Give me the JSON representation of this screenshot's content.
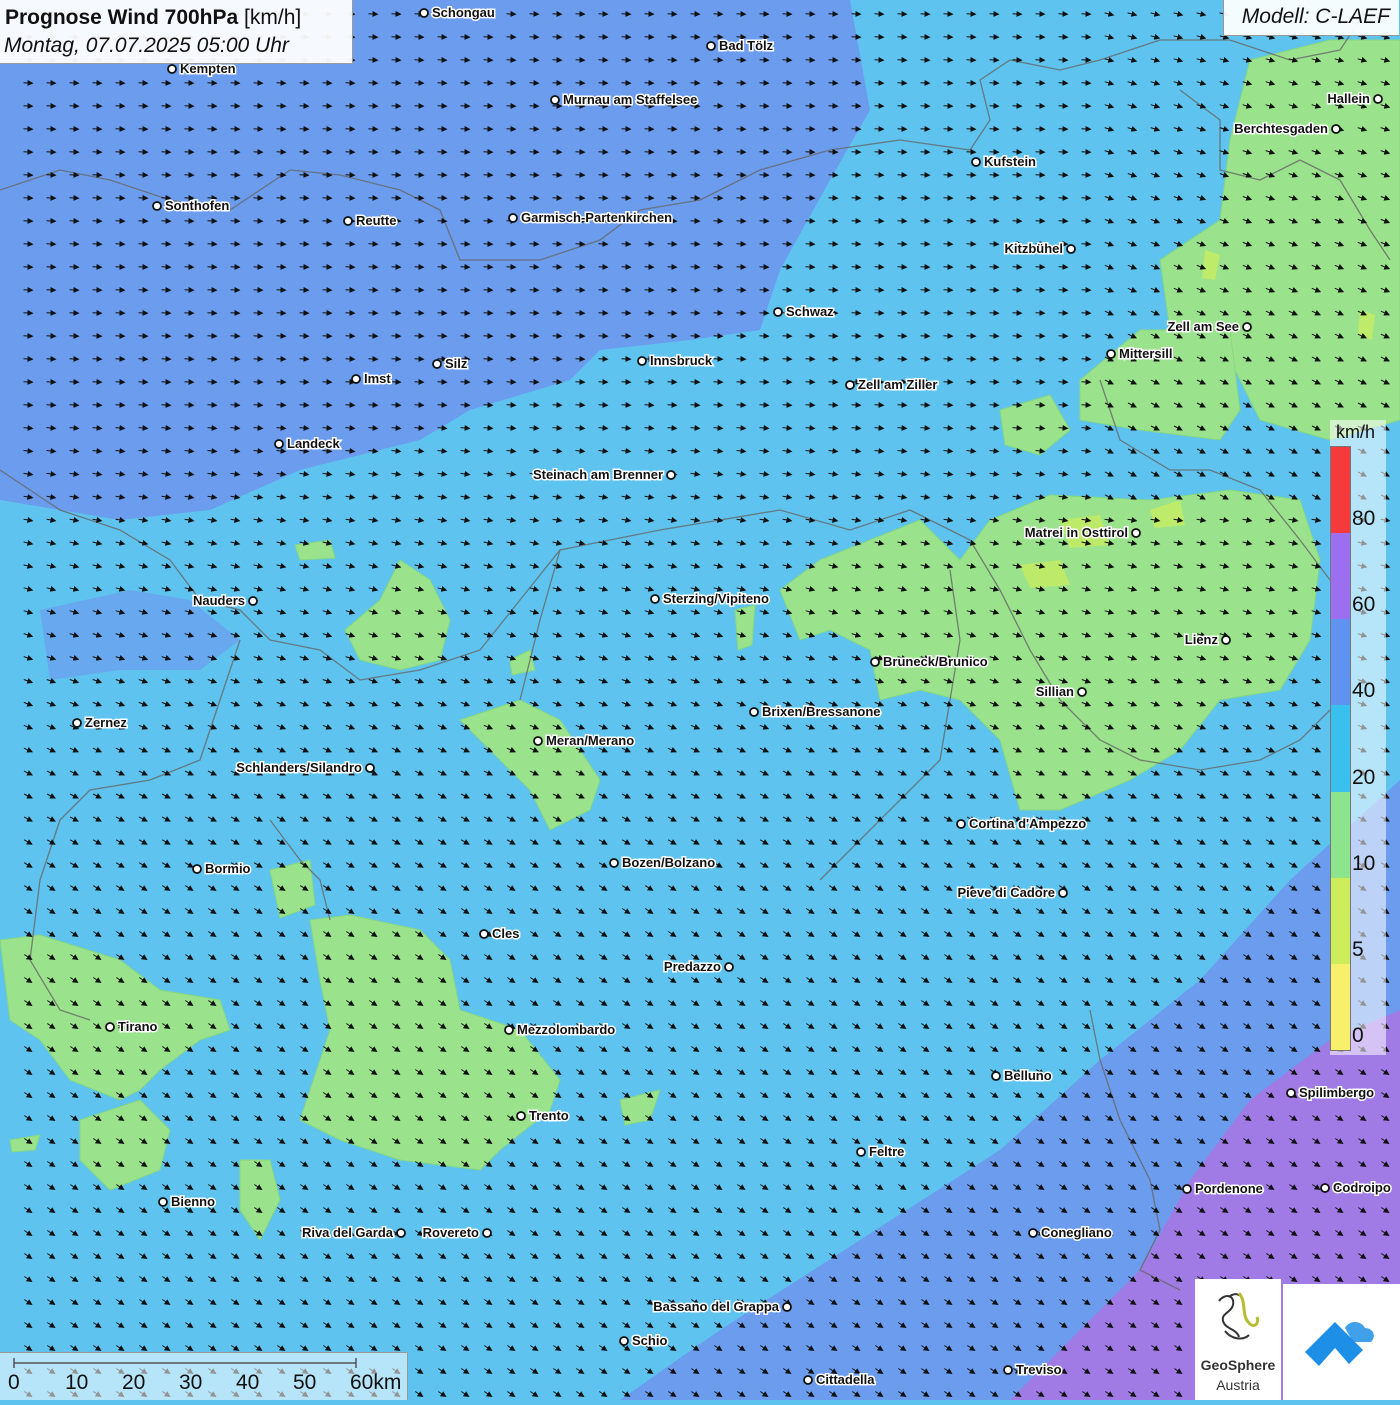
{
  "header": {
    "title_bold": "Prognose Wind 700hPa",
    "title_unit": "[km/h]",
    "datetime": "Montag, 07.07.2025 05:00 Uhr",
    "model": "Modell: C-LAEF"
  },
  "legend": {
    "unit": "km/h",
    "ticks": [
      "80",
      "60",
      "40",
      "20",
      "10",
      "5",
      "0"
    ],
    "colors": [
      "#f43a3a",
      "#9c6ef0",
      "#5e93f0",
      "#38c0ef",
      "#8ce58c",
      "#cdee5a",
      "#f8f06a"
    ]
  },
  "scale": {
    "labels": [
      "0",
      "10",
      "20",
      "30",
      "40",
      "50",
      "60km"
    ]
  },
  "logos": {
    "geosphere_name": "GeoSphere",
    "geosphere_sub": "Austria"
  },
  "places": [
    {
      "name": "Schongau"
    },
    {
      "name": "Bad Tölz"
    },
    {
      "name": "Kempten"
    },
    {
      "name": "Murnau am Staffelsee"
    },
    {
      "name": "Hallein"
    },
    {
      "name": "Berchtesgaden"
    },
    {
      "name": "Kufstein"
    },
    {
      "name": "Sonthofen"
    },
    {
      "name": "Reutte"
    },
    {
      "name": "Garmisch-Partenkirchen"
    },
    {
      "name": "Kitzbühel"
    },
    {
      "name": "Schwaz"
    },
    {
      "name": "Zell am See"
    },
    {
      "name": "Mittersill"
    },
    {
      "name": "Innsbruck"
    },
    {
      "name": "Silz"
    },
    {
      "name": "Imst"
    },
    {
      "name": "Zell am Ziller"
    },
    {
      "name": "Landeck"
    },
    {
      "name": "Steinach am Brenner"
    },
    {
      "name": "Matrei in Osttirol"
    },
    {
      "name": "Nauders"
    },
    {
      "name": "Sterzing/Vipiteno"
    },
    {
      "name": "Lienz"
    },
    {
      "name": "Bruneck/Brunico"
    },
    {
      "name": "Sillian"
    },
    {
      "name": "Brixen/Bressanone"
    },
    {
      "name": "Zernez"
    },
    {
      "name": "Meran/Merano"
    },
    {
      "name": "Schlanders/Silandro"
    },
    {
      "name": "Cortina d'Ampezzo"
    },
    {
      "name": "Bozen/Bolzano"
    },
    {
      "name": "Bormio"
    },
    {
      "name": "Pieve di Cadore"
    },
    {
      "name": "Cles"
    },
    {
      "name": "Predazzo"
    },
    {
      "name": "Tirano"
    },
    {
      "name": "Mezzolombardo"
    },
    {
      "name": "Belluno"
    },
    {
      "name": "Spilimbergo"
    },
    {
      "name": "Trento"
    },
    {
      "name": "Feltre"
    },
    {
      "name": "Pordenone"
    },
    {
      "name": "Codroipo"
    },
    {
      "name": "Bienno"
    },
    {
      "name": "Riva del Garda"
    },
    {
      "name": "Rovereto"
    },
    {
      "name": "Conegliano"
    },
    {
      "name": "Bassano del Grappa"
    },
    {
      "name": "Schio"
    },
    {
      "name": "Treviso"
    },
    {
      "name": "Cittadella"
    }
  ]
}
